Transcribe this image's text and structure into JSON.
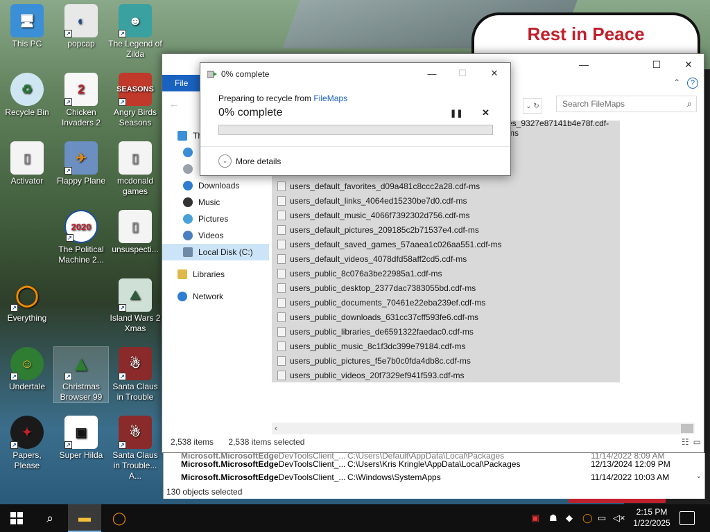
{
  "desktop": {
    "wallpaper_text": "Rest in Peace",
    "icons": [
      {
        "label": "This PC",
        "icon": "monitor-icon"
      },
      {
        "label": "popcap",
        "icon": "popcap-icon"
      },
      {
        "label": "The Legend of Zilda",
        "icon": "zilda-game-icon"
      },
      {
        "label": "Recycle Bin",
        "icon": "recycle-bin-icon"
      },
      {
        "label": "Chicken Invaders 2",
        "icon": "chicken-icon"
      },
      {
        "label": "Angry Birds Seasons",
        "icon": "angry-bird-icon"
      },
      {
        "label": "Activator",
        "icon": "file-icon"
      },
      {
        "label": "Flappy Plane",
        "icon": "plane-icon"
      },
      {
        "label": "mcdonald games",
        "icon": "file-icon"
      },
      {
        "label": "The Political Machine 2...",
        "icon": "political-2020-icon"
      },
      {
        "label": "unsuspecti...",
        "icon": "file-icon"
      },
      {
        "label": "Everything",
        "icon": "everything-search-icon"
      },
      {
        "label": "Island Wars 2 Xmas",
        "icon": "island-icon"
      },
      {
        "label": "Undertale",
        "icon": "undertale-icon"
      },
      {
        "label": "Christmas Browser 99",
        "icon": "christmas-tree-icon",
        "badge": "99"
      },
      {
        "label": "Santa Claus in Trouble",
        "icon": "santa-icon"
      },
      {
        "label": "Papers, Please",
        "icon": "papers-please-icon"
      },
      {
        "label": "Super Hilda",
        "icon": "hilda-icon"
      },
      {
        "label": "Santa Claus in Trouble... A...",
        "icon": "santa-icon"
      }
    ]
  },
  "explorer": {
    "menu_file": "File",
    "search_placeholder": "Search FileMaps",
    "nav_partial_label": "Th",
    "nav_items": [
      {
        "label": "Downloads",
        "icon": "downloads-icon"
      },
      {
        "label": "Music",
        "icon": "music-icon"
      },
      {
        "label": "Pictures",
        "icon": "pictures-icon"
      },
      {
        "label": "Videos",
        "icon": "videos-icon"
      },
      {
        "label": "Local Disk (C:)",
        "icon": "disk-icon"
      },
      {
        "label": "Libraries",
        "icon": "libraries-icon"
      },
      {
        "label": "Network",
        "icon": "network-icon"
      }
    ],
    "files_partial": [
      "es_9327e87141b4e78f.cdf-ms"
    ],
    "files": [
      "users_default_favorites_d09a481c8ccc2a28.cdf-ms",
      "users_default_links_4064ed15230be7d0.cdf-ms",
      "users_default_music_4066f7392302d756.cdf-ms",
      "users_default_pictures_209185c2b71537e4.cdf-ms",
      "users_default_saved_games_57aaea1c026aa551.cdf-ms",
      "users_default_videos_4078dfd58aff2cd5.cdf-ms",
      "users_public_8c076a3be22985a1.cdf-ms",
      "users_public_desktop_2377dac7383055bd.cdf-ms",
      "users_public_documents_70461e22eba239ef.cdf-ms",
      "users_public_downloads_631cc37cff593fe6.cdf-ms",
      "users_public_libraries_de6591322faedac0.cdf-ms",
      "users_public_music_8c1f3dc399e79184.cdf-ms",
      "users_public_pictures_f5e7b0c0fda4db8c.cdf-ms",
      "users_public_videos_20f7329ef941f593.cdf-ms"
    ],
    "status_items": "2,538 items",
    "status_selected": "2,538 items selected"
  },
  "behind_window": {
    "rows": [
      {
        "name_bold": "Microsoft.MicrosoftEdge",
        "name_rest": "DevToolsClient_...",
        "path": "C:\\Users\\Default\\AppData\\Local\\Packages",
        "date": "11/14/2022 8:09 AM"
      },
      {
        "name_bold": "Microsoft.MicrosoftEdge",
        "name_rest": "DevToolsClient_...",
        "path": "C:\\Users\\Kris Kringle\\AppData\\Local\\Packages",
        "date": "12/13/2024 12:09 PM"
      },
      {
        "name_bold": "Microsoft.MicrosoftEdge",
        "name_rest": "DevToolsClient_...",
        "path": "C:\\Windows\\SystemApps",
        "date": "11/14/2022 10:03 AM"
      }
    ],
    "status": "130 objects selected"
  },
  "dialog": {
    "title": "0% complete",
    "preparing_text": "Preparing to recycle from ",
    "source_link": "FileMaps",
    "percent_text": "0% complete",
    "progress": 0,
    "more_details": "More details",
    "colors": {
      "progress_fill": "#06b025",
      "link": "#1a62c0"
    }
  },
  "taskbar": {
    "time": "2:15 PM",
    "date": "1/22/2025"
  }
}
